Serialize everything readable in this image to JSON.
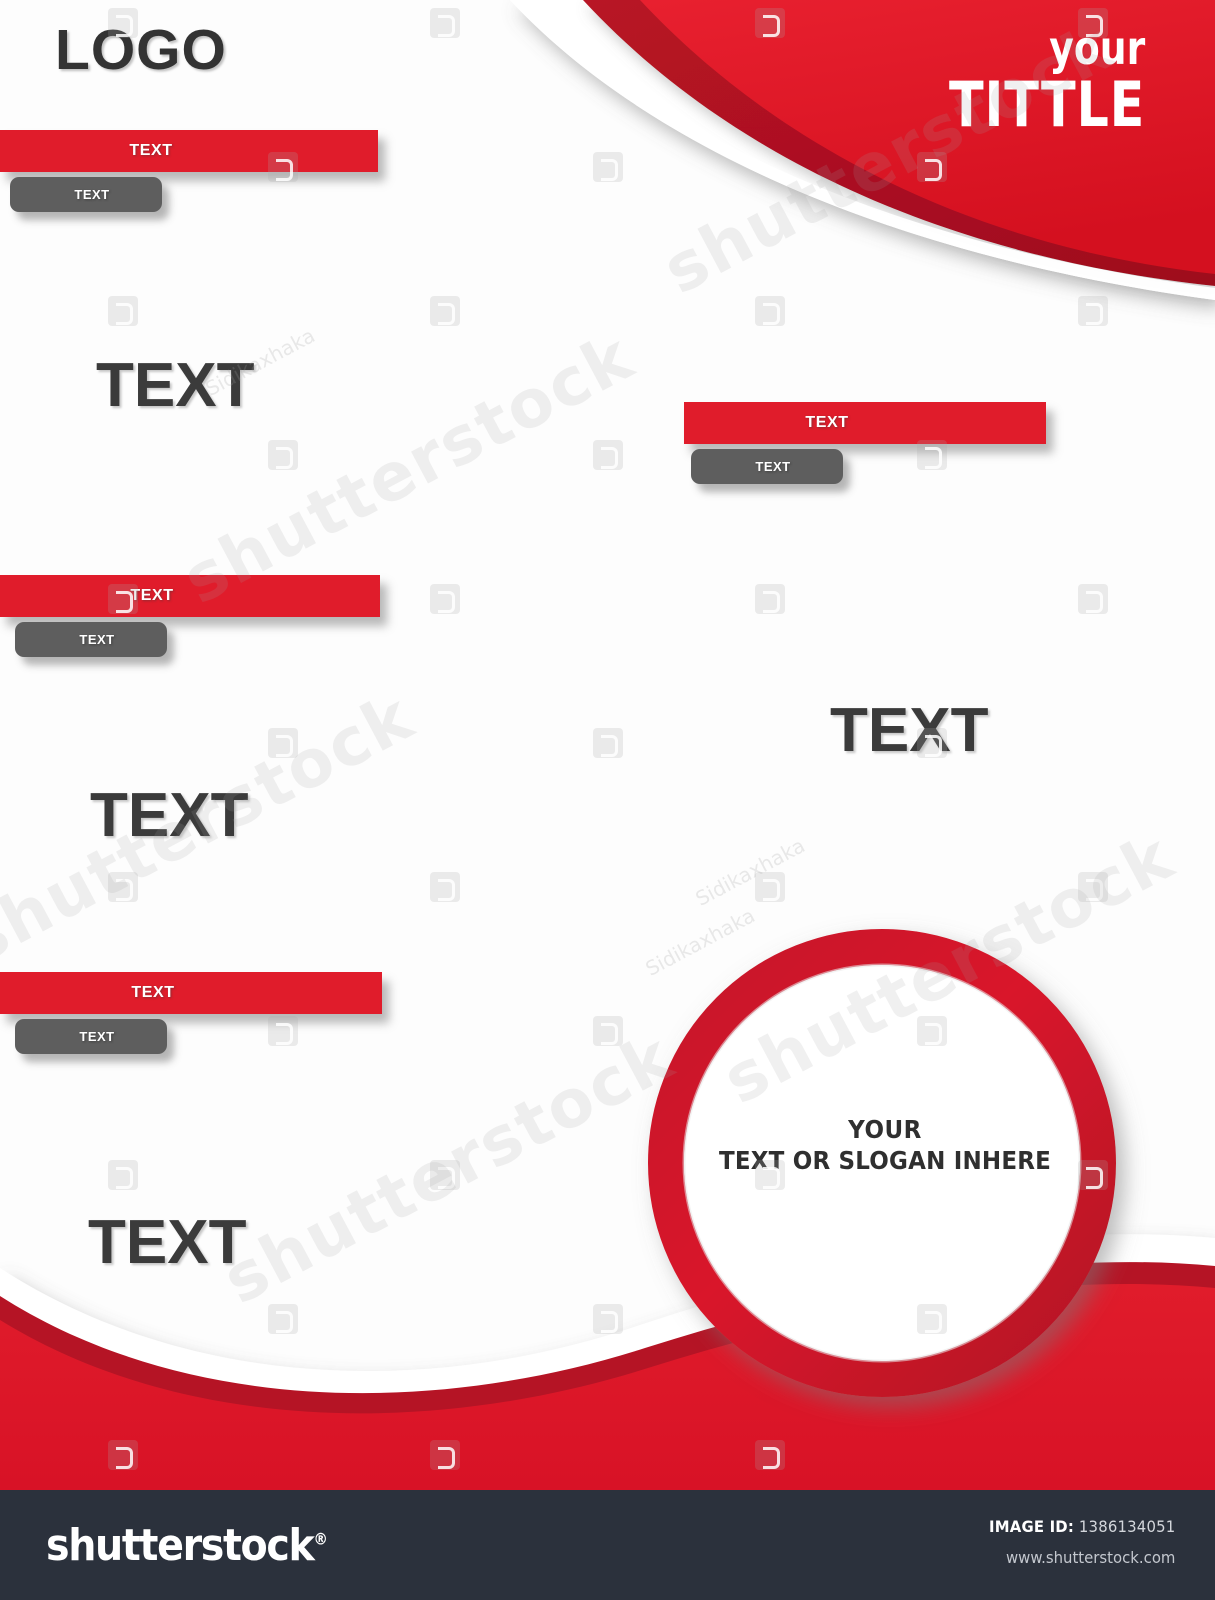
{
  "poster": {
    "logo": "LOGO",
    "title": {
      "line_small": "your",
      "line_big": "TITTLE"
    },
    "headings": [
      {
        "label": "TEXT"
      },
      {
        "label": "TEXT"
      },
      {
        "label": "TEXT"
      },
      {
        "label": "TEXT"
      }
    ],
    "banner_groups": [
      {
        "bar_label": "TEXT",
        "pill_label": "TEXT"
      },
      {
        "bar_label": "TEXT",
        "pill_label": "TEXT"
      },
      {
        "bar_label": "TEXT",
        "pill_label": "TEXT"
      },
      {
        "bar_label": "TEXT",
        "pill_label": "TEXT"
      }
    ],
    "circle": {
      "line1": "YOUR",
      "line2": "TEXT OR SLOGAN INHERE"
    },
    "colors": {
      "red": "#E01C2B",
      "red_dark": "#B51425",
      "red_deep": "#C01225",
      "gray_pill": "#5E5E5E",
      "heading_gray": "#3B3B3B",
      "footer_bg": "#2B313C",
      "white": "#FFFFFF"
    }
  },
  "watermark": {
    "brand": "shutterstock",
    "artist": "Sidikaxhaka"
  },
  "footer": {
    "brand": "shutterstock",
    "registered_mark": "®",
    "image_id_label": "IMAGE ID:",
    "image_id_value": "1386134051",
    "website": "www.shutterstock.com"
  }
}
